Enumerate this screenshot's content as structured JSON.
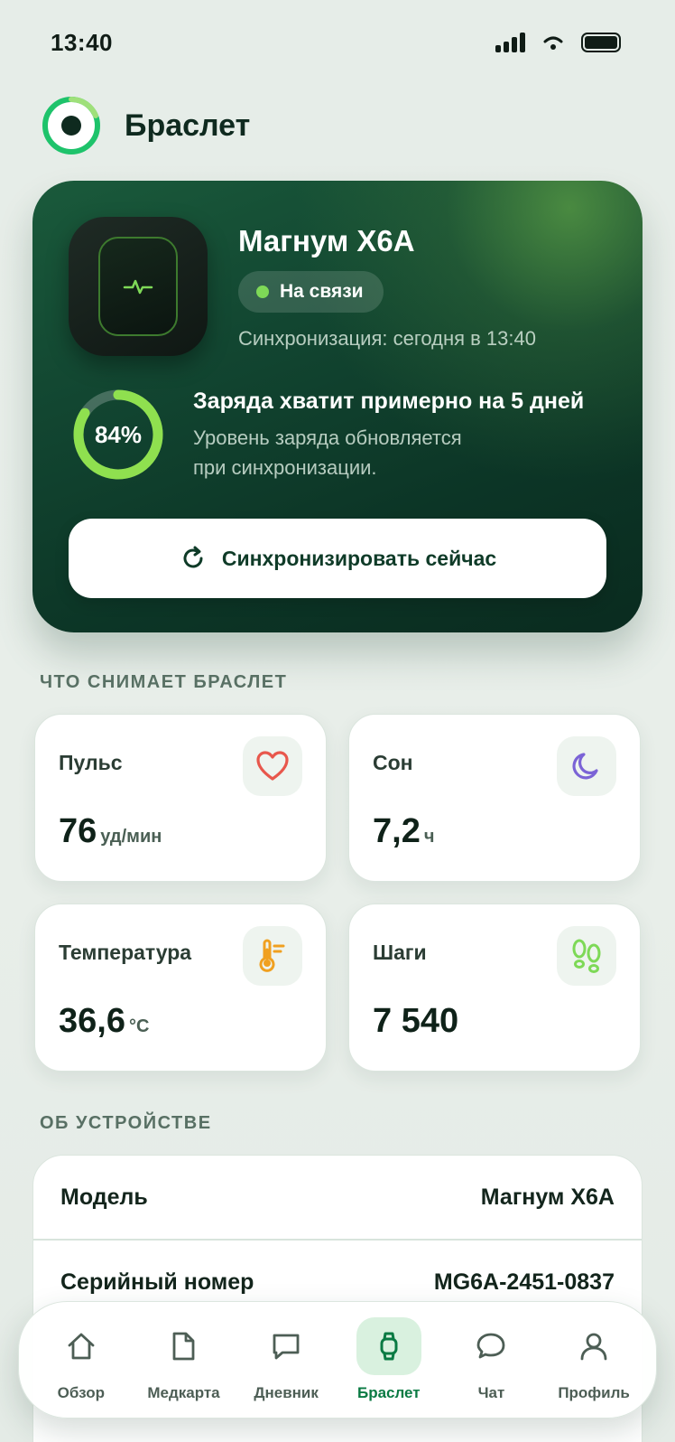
{
  "status_bar": {
    "time": "13:40"
  },
  "header": {
    "title": "Браслет"
  },
  "device": {
    "name": "Магнум X6A",
    "connection_status": "На связи",
    "sync_info": "Синхронизация: сегодня в 13:40",
    "battery_percent_label": "84%",
    "battery_level": 0.84,
    "battery_title": "Заряда хватит примерно на 5 дней",
    "battery_note": "Уровень заряда обновляется при синхронизации.",
    "sync_button_label": "Синхронизировать сейчас"
  },
  "metrics_section": {
    "heading": "ЧТО СНИМАЕТ БРАСЛЕТ",
    "items": [
      {
        "label": "Пульс",
        "value": "76",
        "unit": "уд/мин",
        "icon": "heart-icon",
        "icon_color": "#e8574c"
      },
      {
        "label": "Сон",
        "value": "7,2",
        "unit": "ч",
        "icon": "moon-icon",
        "icon_color": "#7b63d6"
      },
      {
        "label": "Температура",
        "value": "36,6",
        "unit": "°C",
        "icon": "thermometer-icon",
        "icon_color": "#f0a020"
      },
      {
        "label": "Шаги",
        "value": "7 540",
        "unit": "",
        "icon": "footsteps-icon",
        "icon_color": "#7ed957"
      }
    ]
  },
  "about_section": {
    "heading": "ОБ УСТРОЙСТВЕ",
    "rows": [
      {
        "key": "Модель",
        "value": "Магнум X6A"
      },
      {
        "key": "Серийный номер",
        "value": "MG6A-2451-0837"
      }
    ]
  },
  "bottom_nav": {
    "items": [
      {
        "label": "Обзор",
        "icon": "home-icon",
        "active": false
      },
      {
        "label": "Медкарта",
        "icon": "document-icon",
        "active": false
      },
      {
        "label": "Дневник",
        "icon": "message-square-icon",
        "active": false
      },
      {
        "label": "Браслет",
        "icon": "watch-icon",
        "active": true
      },
      {
        "label": "Чат",
        "icon": "chat-bubble-icon",
        "active": false
      },
      {
        "label": "Профиль",
        "icon": "user-icon",
        "active": false
      }
    ]
  },
  "colors": {
    "brand_green": "#0a7a43",
    "accent_lime": "#7ed957",
    "card_dark": "#0c3526"
  }
}
